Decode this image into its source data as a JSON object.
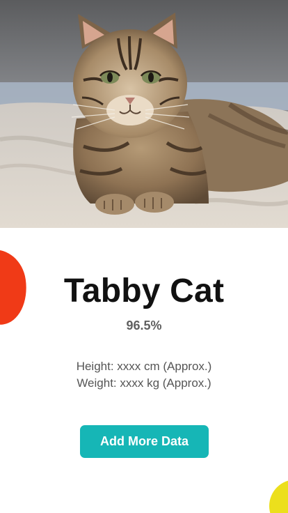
{
  "pet": {
    "breed": "Tabby Cat",
    "confidence": "96.5%",
    "height_line": "Height: xxxx cm (Approx.)",
    "weight_line": "Weight: xxxx kg (Approx.)"
  },
  "actions": {
    "add_more_label": "Add More Data"
  },
  "colors": {
    "accent": "#16b6b6",
    "blob_red": "#f03a17",
    "blob_yellow": "#ecdf1c",
    "title": "#111111",
    "muted": "#5f5f5f"
  }
}
